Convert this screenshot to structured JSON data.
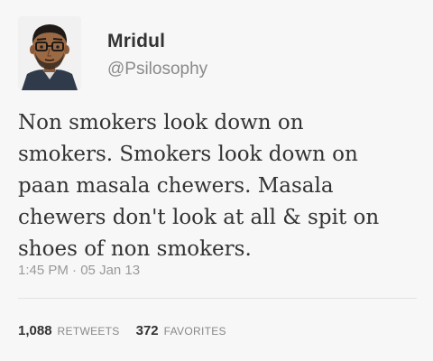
{
  "user": {
    "name": "Mridul",
    "handle": "@Psilosophy",
    "avatar_icon": "cartoon-avatar-icon"
  },
  "tweet": {
    "text": "Non smokers look down on\nsmokers. Smokers look down on\npaan masala chewers. Masala\nchewers don't look at all & spit on\nshoes of non smokers.",
    "time": "1:45 PM",
    "separator": " · ",
    "date": "05 Jan 13"
  },
  "stats": {
    "retweets_count": "1,088",
    "retweets_label": "RETWEETS",
    "favorites_count": "372",
    "favorites_label": "FAVORITES"
  },
  "colors": {
    "background": "#f7f7f7",
    "text": "#333333",
    "muted": "#8a8a8a"
  }
}
